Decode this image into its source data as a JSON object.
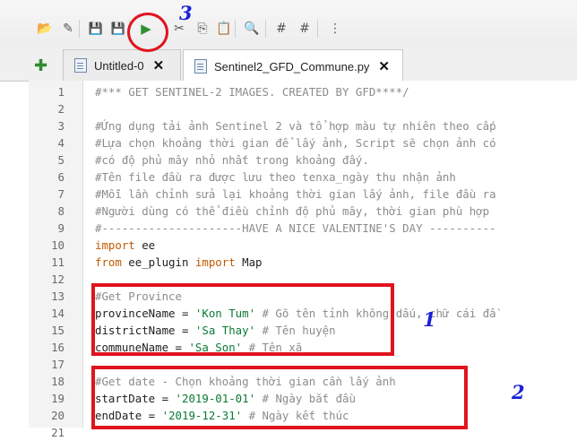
{
  "toolbar": {
    "tools": [
      {
        "name": "open-folder-icon",
        "glyph": "📂"
      },
      {
        "name": "edit-file-icon",
        "glyph": "✎"
      },
      {
        "name": "save-icon",
        "glyph": "💾"
      },
      {
        "name": "save-as-icon",
        "glyph": "💾"
      },
      {
        "name": "run-icon",
        "glyph": "▶"
      },
      {
        "name": "cut-icon",
        "glyph": "✂"
      },
      {
        "name": "copy-icon",
        "glyph": "⎘"
      },
      {
        "name": "paste-icon",
        "glyph": "📋"
      },
      {
        "name": "find-icon",
        "glyph": "🔍"
      },
      {
        "name": "comment-icon",
        "glyph": "#"
      },
      {
        "name": "uncomment-icon",
        "glyph": "#"
      },
      {
        "name": "tree-icon",
        "glyph": "⋮"
      }
    ]
  },
  "tabs": [
    {
      "label": "Untitled-0",
      "close": "✕",
      "active": false
    },
    {
      "label": "Sentinel2_GFD_Commune.py",
      "close": "✕",
      "active": true
    }
  ],
  "add_tab_glyph": "✚",
  "editor": {
    "lines": [
      {
        "n": "1",
        "text": "#*** GET SENTINEL-2 IMAGES. CREATED BY GFD****/",
        "style": "comment"
      },
      {
        "n": "2",
        "text": "",
        "style": "plain"
      },
      {
        "n": "3",
        "text": "#Ứng dụng tải ảnh Sentinel 2 và tổ hợp màu tự nhiên theo cấp",
        "style": "comment"
      },
      {
        "n": "4",
        "text": "#Lựa chọn khoảng thời gian để lấy ảnh, Script sẽ chọn ảnh có",
        "style": "comment"
      },
      {
        "n": "5",
        "text": "#có độ phủ mây nhỏ nhất trong khoảng đấy.",
        "style": "comment"
      },
      {
        "n": "6",
        "text": "#Tên file đầu ra được lưu theo tenxa_ngày thu nhận ảnh",
        "style": "comment"
      },
      {
        "n": "7",
        "text": "#Mỗi lần chỉnh sửa lại khoảng thời gian lấy ảnh, file đầu ra",
        "style": "comment"
      },
      {
        "n": "8",
        "text": "#Người dùng có thể điều chỉnh độ phủ mây, thời gian phù hợp",
        "style": "comment"
      },
      {
        "n": "9",
        "text": "#---------------------HAVE A NICE VALENTINE'S DAY ----------",
        "style": "comment"
      },
      {
        "n": "10",
        "text": "import ee",
        "style": "import"
      },
      {
        "n": "11",
        "text": "from ee_plugin import Map",
        "style": "from"
      },
      {
        "n": "12",
        "text": "",
        "style": "plain"
      },
      {
        "n": "13",
        "text": "#Get Province",
        "style": "comment"
      },
      {
        "n": "14",
        "text": "provinceName = 'Kon Tum' # Gõ tên tỉnh không dấu, chữ cái đầ",
        "style": "assign"
      },
      {
        "n": "15",
        "text": "districtName = 'Sa Thay' # Tên huyện",
        "style": "assign"
      },
      {
        "n": "16",
        "text": "communeName = 'Sa Son' # Tên xã",
        "style": "assign"
      },
      {
        "n": "17",
        "text": "",
        "style": "plain"
      },
      {
        "n": "18",
        "text": "#Get date - Chọn khoảng thời gian cần lấy ảnh",
        "style": "comment"
      },
      {
        "n": "19",
        "text": "startDate = '2019-01-01' # Ngày bắt đầu",
        "style": "assign"
      },
      {
        "n": "20",
        "text": "endDate = '2019-12-31' # Ngày kết thúc",
        "style": "assign"
      },
      {
        "n": "21",
        "text": "",
        "style": "plain"
      }
    ]
  },
  "annotations": {
    "label_1": "1",
    "label_2": "2",
    "label_3": "3",
    "box_color": "#e0141e",
    "label_color": "#1a20d8"
  }
}
